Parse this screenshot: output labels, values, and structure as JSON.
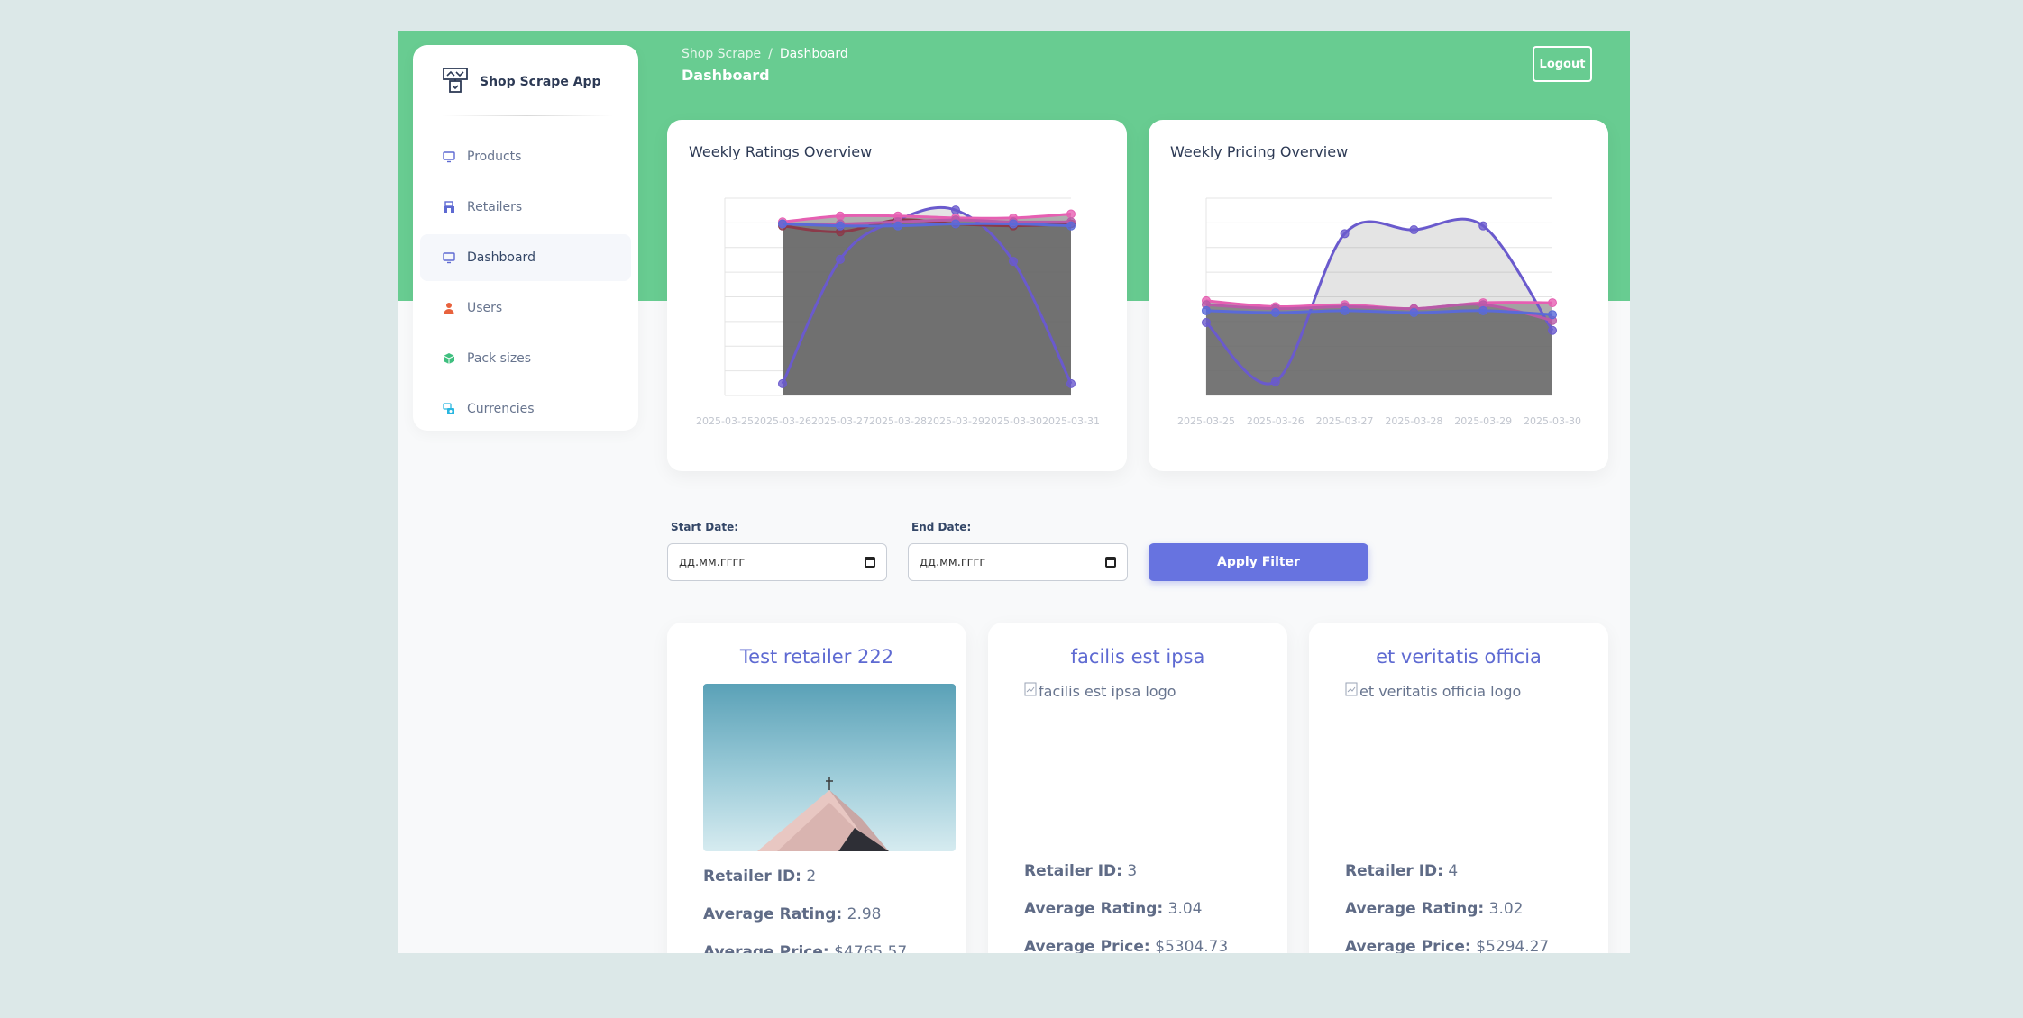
{
  "sidebar": {
    "app_name": "Shop Scrape App",
    "items": [
      {
        "label": "Products",
        "icon": "monitor-icon"
      },
      {
        "label": "Retailers",
        "icon": "shop-icon"
      },
      {
        "label": "Dashboard",
        "icon": "monitor-icon",
        "active": true
      },
      {
        "label": "Users",
        "icon": "user-icon"
      },
      {
        "label": "Pack sizes",
        "icon": "box-icon"
      },
      {
        "label": "Currencies",
        "icon": "currency-icon"
      }
    ]
  },
  "header": {
    "breadcrumb_root": "Shop Scrape",
    "breadcrumb_sep": "/",
    "breadcrumb_current": "Dashboard",
    "title": "Dashboard",
    "logout_label": "Logout"
  },
  "filters": {
    "start_label": "Start Date:",
    "end_label": "End Date:",
    "start_value": "дд.мм.гггг",
    "end_value": "дд.мм.гггг",
    "apply_label": "Apply Filter"
  },
  "retailers": [
    {
      "name": "Test retailer 222",
      "alt": "",
      "id_label": "Retailer ID:",
      "id": "2",
      "rating_label": "Average Rating:",
      "rating": "2.98",
      "price_label": "Average Price:",
      "price": "$4765.57"
    },
    {
      "name": "facilis est ipsa",
      "alt": "facilis est ipsa logo",
      "id_label": "Retailer ID:",
      "id": "3",
      "rating_label": "Average Rating:",
      "rating": "3.04",
      "price_label": "Average Price:",
      "price": "$5304.73"
    },
    {
      "name": "et veritatis officia",
      "alt": "et veritatis officia logo",
      "id_label": "Retailer ID:",
      "id": "4",
      "rating_label": "Average Rating:",
      "rating": "3.02",
      "price_label": "Average Price:",
      "price": "$5294.27"
    }
  ],
  "colors": {
    "brand_green": "#68cc91",
    "accent": "#6773e0",
    "fill_dark": "#6b6b6b",
    "series_purple": "#6a5acd",
    "series_pink": "#e65fb2",
    "series_red": "#8b3a4a"
  },
  "chart_data": [
    {
      "type": "area",
      "title": "Weekly Ratings Overview",
      "x": [
        "2025-03-25",
        "2025-03-26",
        "2025-03-27",
        "2025-03-28",
        "2025-03-29",
        "2025-03-30",
        "2025-03-31"
      ],
      "ylim": [
        0,
        1
      ],
      "grid": true,
      "series": [
        {
          "color": "#6a5acd",
          "values": [
            null,
            0.06,
            0.69,
            0.89,
            0.94,
            0.68,
            0.06
          ]
        },
        {
          "color": "#8b3a4a",
          "values": [
            null,
            0.86,
            0.83,
            0.89,
            0.87,
            0.86,
            0.87
          ]
        },
        {
          "color": "#e65fb2",
          "values": [
            null,
            0.88,
            0.91,
            0.91,
            0.9,
            0.9,
            0.92
          ]
        },
        {
          "color": "#b85aa8",
          "values": [
            null,
            0.87,
            0.87,
            0.88,
            0.89,
            0.88,
            0.88
          ]
        },
        {
          "color": "#5a6ad8",
          "values": [
            null,
            0.87,
            0.86,
            0.86,
            0.87,
            0.87,
            0.86
          ]
        }
      ]
    },
    {
      "type": "area",
      "title": "Weekly Pricing Overview",
      "x": [
        "2025-03-25",
        "2025-03-26",
        "2025-03-27",
        "2025-03-28",
        "2025-03-29",
        "2025-03-30"
      ],
      "ylim": [
        0,
        1
      ],
      "grid": true,
      "series": [
        {
          "color": "#6a5acd",
          "values": [
            0.37,
            0.07,
            0.82,
            0.84,
            0.86,
            0.33
          ]
        },
        {
          "color": "#e65fb2",
          "values": [
            0.48,
            0.45,
            0.46,
            0.44,
            0.47,
            0.47
          ]
        },
        {
          "color": "#b85aa8",
          "values": [
            0.46,
            0.44,
            0.45,
            0.44,
            0.46,
            0.38
          ]
        },
        {
          "color": "#5a6ad8",
          "values": [
            0.43,
            0.42,
            0.43,
            0.42,
            0.43,
            0.41
          ]
        }
      ]
    }
  ]
}
